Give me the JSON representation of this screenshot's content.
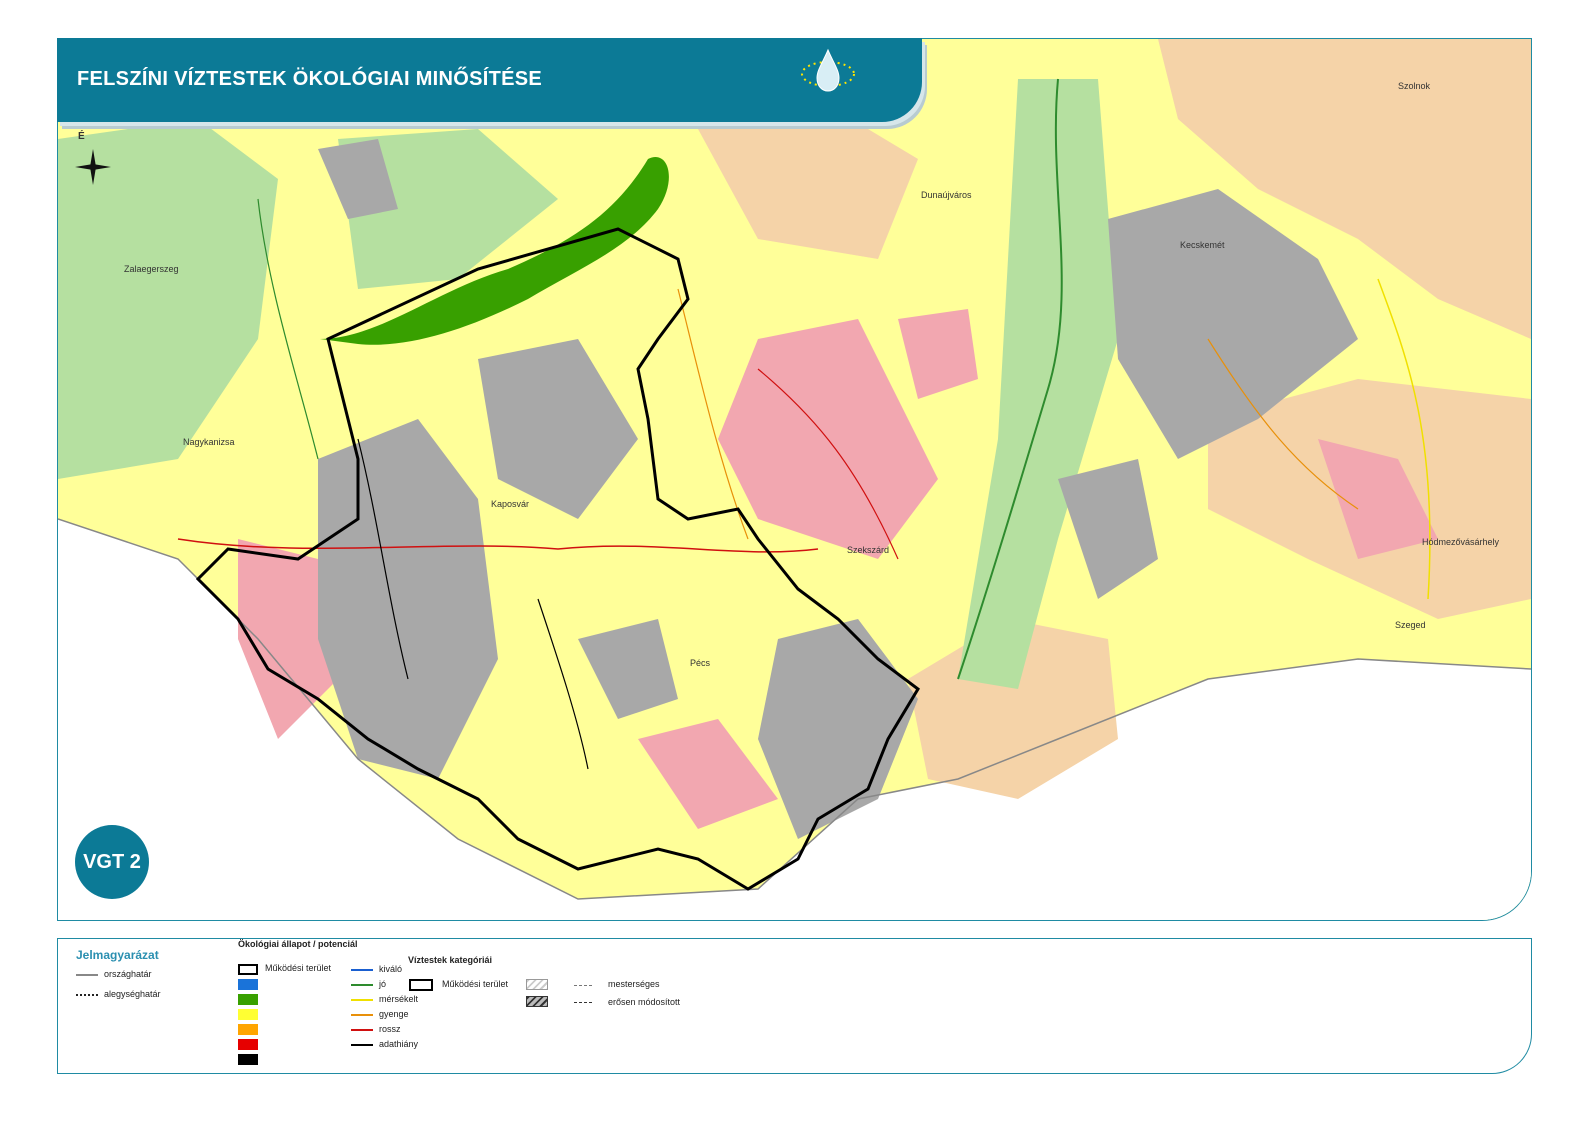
{
  "header": {
    "title": "FELSZÍNI VÍZTESTEK ÖKOLÓGIAI MINŐSÍTÉSE",
    "badge": "VGT 2",
    "north_label": "É"
  },
  "places": [
    {
      "name": "Zalaegerszeg"
    },
    {
      "name": "Nagykanizsa"
    },
    {
      "name": "Kaposvár"
    },
    {
      "name": "Pécs"
    },
    {
      "name": "Szekszárd"
    },
    {
      "name": "Dunaújváros"
    },
    {
      "name": "Kecskemét"
    },
    {
      "name": "Szolnok"
    },
    {
      "name": "Hódmezővásárhely"
    },
    {
      "name": "Szeged"
    }
  ],
  "legend": {
    "title": "Jelmagyarázat",
    "borders": [
      {
        "label": "országhatár",
        "style": "solid",
        "color": "#888888"
      },
      {
        "label": "alegységhatár",
        "style": "dotted",
        "color": "#222222"
      }
    ],
    "status_title": "Ökológiai állapot / potenciál",
    "area_item": "Működési terület",
    "area_swatches": [
      "#1a73d9",
      "#38a000",
      "#ffff33",
      "#ffa500",
      "#e60000",
      "#000000"
    ],
    "line_items": [
      {
        "label": "kiváló",
        "color": "#1a5fd0"
      },
      {
        "label": "jó",
        "color": "#2e8b2e"
      },
      {
        "label": "mérsékelt",
        "color": "#f0e000"
      },
      {
        "label": "gyenge",
        "color": "#e8900a"
      },
      {
        "label": "rossz",
        "color": "#d01010"
      },
      {
        "label": "adathiány",
        "color": "#000000"
      }
    ],
    "category_title": "Víztestek kategóriái",
    "category_area": "Működési terület",
    "categories": [
      {
        "label": "mesterséges"
      },
      {
        "label": "erősen módosított"
      }
    ]
  },
  "colors": {
    "accent": "#0c7a96",
    "fill_good": "#b5e0a0",
    "fill_moderate": "#ffff99",
    "fill_poor": "#f5d3a8",
    "fill_bad": "#f2a7b0",
    "fill_nodata": "#a8a8a8",
    "lake": "#38a000"
  }
}
